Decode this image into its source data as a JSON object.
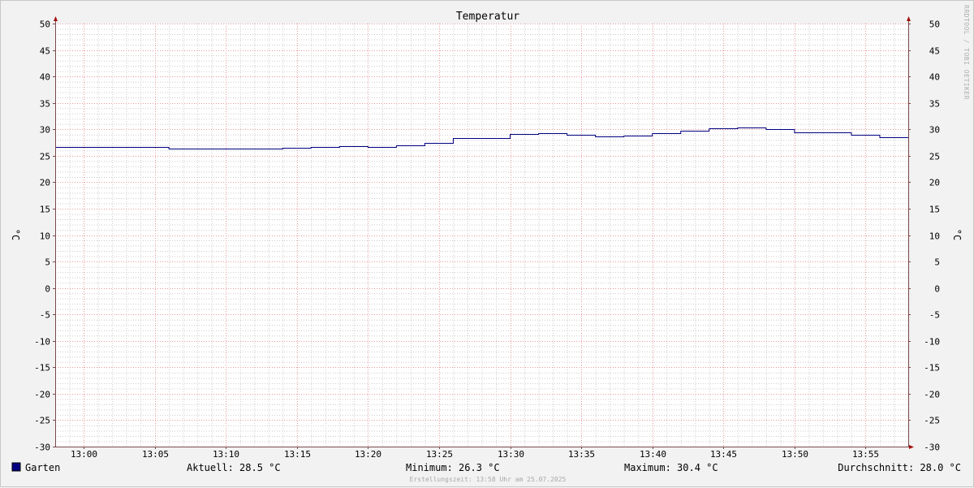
{
  "chart_data": {
    "type": "line",
    "title": "Temperatur",
    "ylabel": "°C",
    "ylabel_right": "°C",
    "ylim": [
      -30,
      50
    ],
    "y_ticks": [
      "50",
      "45",
      "40",
      "35",
      "30",
      "25",
      "20",
      "15",
      "10",
      "5",
      "0",
      "-5",
      "-10",
      "-15",
      "-20",
      "-25",
      "-30"
    ],
    "x_ticks": [
      "13:00",
      "13:05",
      "13:10",
      "13:15",
      "13:20",
      "13:25",
      "13:30",
      "13:35",
      "13:40",
      "13:45",
      "13:50",
      "13:55"
    ],
    "x_range": [
      "12:58",
      "13:58"
    ],
    "grid": true,
    "line_step": true,
    "series": [
      {
        "name": "Garten",
        "color": "#000080",
        "x": [
          "12:58",
          "13:02",
          "13:06",
          "13:14",
          "13:16",
          "13:18",
          "13:20",
          "13:22",
          "13:24",
          "13:26",
          "13:30",
          "13:32",
          "13:34",
          "13:36",
          "13:38",
          "13:40",
          "13:42",
          "13:44",
          "13:46",
          "13:48",
          "13:50",
          "13:54",
          "13:56",
          "13:58"
        ],
        "values": [
          26.7,
          26.6,
          26.4,
          26.5,
          26.7,
          26.8,
          26.7,
          26.9,
          27.4,
          28.3,
          29.1,
          29.3,
          29.0,
          28.7,
          28.8,
          29.3,
          29.8,
          30.2,
          30.4,
          30.0,
          29.5,
          28.9,
          28.5,
          28.5
        ]
      }
    ],
    "legend": {
      "label": "Garten",
      "color": "#000080"
    },
    "stats": {
      "current": "Aktuell: 28.5 °C",
      "minimum": "Minimum: 26.3 °C",
      "maximum": "Maximum: 30.4 °C",
      "average": "Durchschnitt: 28.0 °C"
    },
    "footer": "Erstellungszeit: 13:58 Uhr am 25.07.2025",
    "watermark": "RRDTOOL / TOBI OETIKER",
    "colors": {
      "major_grid": "#e89a9a",
      "minor_grid": "#cccccc",
      "axis": "#7a4a4a",
      "arrow": "#a01010",
      "line": "#000080",
      "canvas": "#ffffff",
      "background": "#f2f2f2"
    }
  }
}
